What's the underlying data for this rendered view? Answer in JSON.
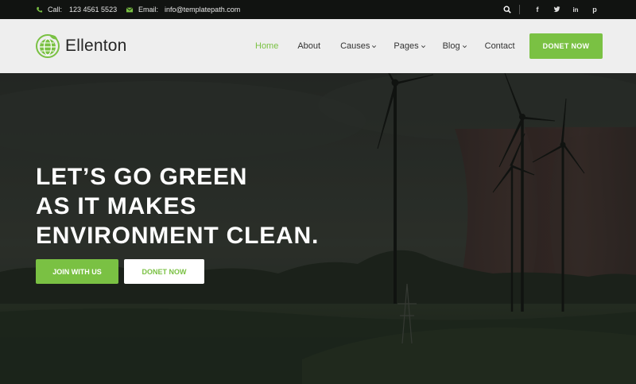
{
  "topbar": {
    "call_label": "Call:",
    "call_number": "123 4561 5523",
    "email_label": "Email:",
    "email_address": "info@templatepath.com",
    "icons": [
      "phone-icon",
      "envelope-icon",
      "search-icon",
      "facebook-icon",
      "twitter-icon",
      "linkedin-icon",
      "pinterest-icon"
    ],
    "social": {
      "facebook": "f",
      "twitter": "t",
      "linkedin": "in",
      "pinterest": "p"
    }
  },
  "brand": {
    "name": "Ellenton",
    "icon": "globe-leaf-icon"
  },
  "nav": {
    "items": [
      {
        "label": "Home",
        "active": true
      },
      {
        "label": "About"
      },
      {
        "label": "Causes",
        "dropdown": true
      },
      {
        "label": "Pages",
        "dropdown": true
      },
      {
        "label": "Blog",
        "dropdown": true
      },
      {
        "label": "Contact"
      }
    ],
    "cta": "DONET NOW"
  },
  "hero": {
    "line1": "LET’S GO GREEN",
    "line2": "AS IT MAKES",
    "line3": "ENVIRONMENT CLEAN.",
    "join_button": "JOIN WITH US",
    "donate_button": "DONET NOW"
  },
  "colors": {
    "accent": "#7ac143",
    "topbar": "#111311",
    "nav": "#eeeeee"
  }
}
